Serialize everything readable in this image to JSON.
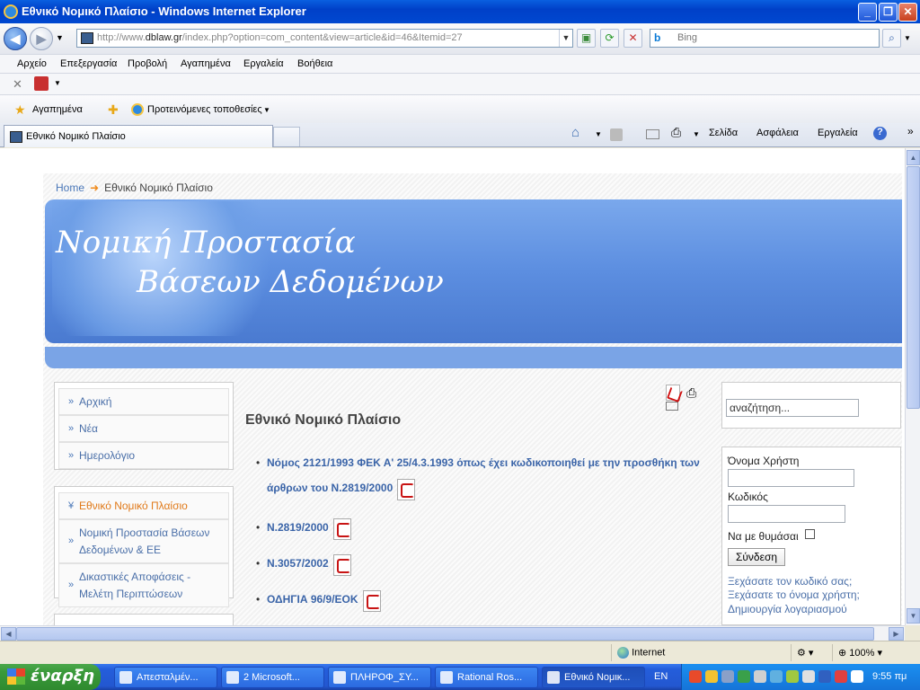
{
  "window": {
    "title": "Εθνικό Νομικό Πλαίσιο - Windows Internet Explorer",
    "min": "_",
    "max": "❐",
    "close": "✕"
  },
  "address": {
    "url_prefix": "http://www.",
    "url_domain": "dblaw.gr",
    "url_rest": "/index.php?option=com_content&view=article&id=46&Itemid=27",
    "search_placeholder": "Bing",
    "search_logo": "b"
  },
  "menu": [
    "Αρχείο",
    "Επεξεργασία",
    "Προβολή",
    "Αγαπημένα",
    "Εργαλεία",
    "Βοήθεια"
  ],
  "favorites": {
    "label": "Αγαπημένα",
    "suggested": "Προτεινόμενες τοποθεσίες"
  },
  "tab": {
    "label": "Εθνικό Νομικό Πλαίσιο"
  },
  "commands": {
    "page": "Σελίδα",
    "safety": "Ασφάλεια",
    "tools": "Εργαλεία"
  },
  "breadcrumb": {
    "home": "Home",
    "current": "Εθνικό Νομικό Πλαίσιο"
  },
  "banner": {
    "line1": "Νομική Προστασία",
    "line2": "Βάσεων Δεδομένων"
  },
  "mainmenu": [
    {
      "label": "Αρχική"
    },
    {
      "label": "Νέα"
    },
    {
      "label": "Ημερολόγιο"
    }
  ],
  "submenu": [
    {
      "label": "Εθνικό Νομικό Πλαίσιο"
    },
    {
      "label": "Νομική Προστασία Βάσεων Δεδομένων & ΕΕ"
    },
    {
      "label": "Δικαστικές Αποφάσεις - Μελέτη Περιπτώσεων"
    }
  ],
  "article": {
    "title": "Εθνικό Νομικό Πλαίσιο",
    "items": [
      "Νόμος 2121/1993 ΦΕΚ Α' 25/4.3.1993 όπως έχει κωδικοποιηθεί με την προσθήκη των άρθρων του Ν.2819/2000",
      "Ν.2819/2000",
      "Ν.3057/2002",
      "ΟΔΗΓΙΑ 96/9/ΕΟΚ"
    ]
  },
  "search": {
    "placeholder": "αναζήτηση..."
  },
  "login": {
    "username_label": "Όνομα Χρήστη",
    "password_label": "Κωδικός",
    "remember_label": "Να με θυμάσαι",
    "submit": "Σύνδεση",
    "forgot_password": "Ξεχάσατε τον κωδικό σας;",
    "forgot_username": "Ξεχάσατε το όνομα χρήστη;",
    "register": "Δημιουργία λογαριασμού"
  },
  "status": {
    "zone": "Internet",
    "zoom": "100%"
  },
  "taskbar": {
    "start": "έναρξη",
    "buttons": [
      "Απεσταλμέν...",
      "2 Microsoft...",
      "ΠΛΗΡΟΦ_ΣΥ...",
      "Rational Ros...",
      "Εθνικό Νομικ..."
    ],
    "lang": "EN",
    "clock": "9:55 πμ"
  }
}
